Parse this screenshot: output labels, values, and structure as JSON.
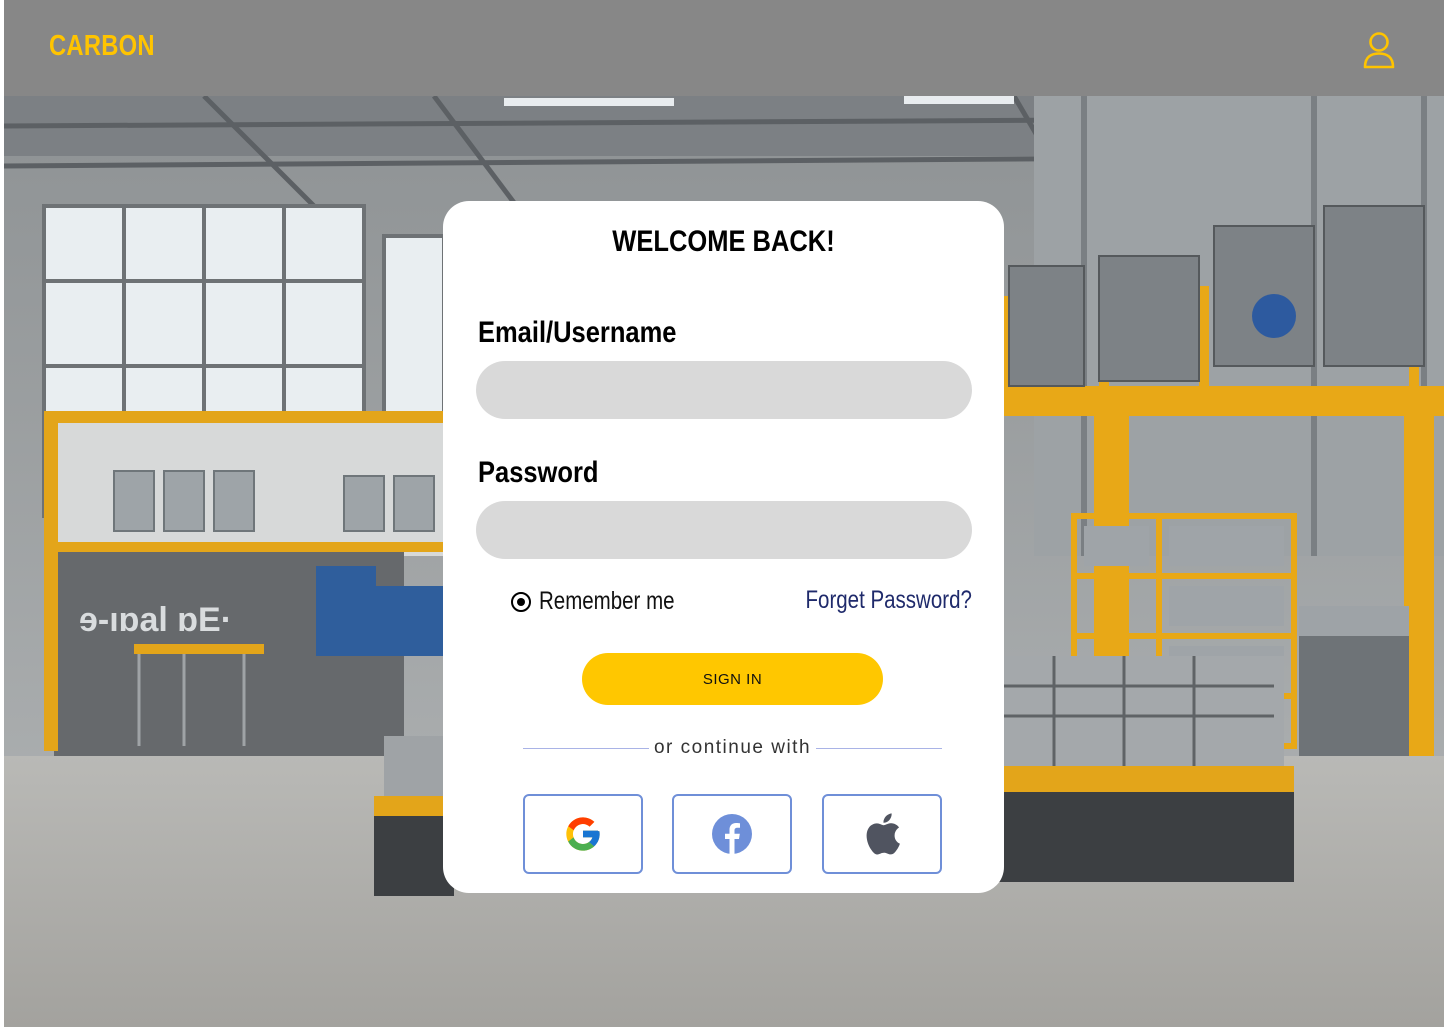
{
  "header": {
    "brand": "CARBON",
    "user_icon": "user-icon",
    "brand_color": "#FFC400",
    "background_color": "#878787"
  },
  "login": {
    "title": "WELCOME BACK!",
    "email_label": "Email/Username",
    "email_value": "",
    "password_label": "Password",
    "password_value": "",
    "remember_label": "Remember me",
    "remember_checked": true,
    "forgot_label": "Forget Password?",
    "signin_label": "SIGN  IN",
    "divider_text": "or continue with",
    "social": [
      {
        "icon": "google-icon"
      },
      {
        "icon": "facebook-icon"
      },
      {
        "icon": "apple-icon"
      }
    ]
  },
  "colors": {
    "accent": "#FFC700",
    "field_bg": "#D9D9D9",
    "link": "#1F2A6B",
    "social_border": "#6F8FD8"
  }
}
